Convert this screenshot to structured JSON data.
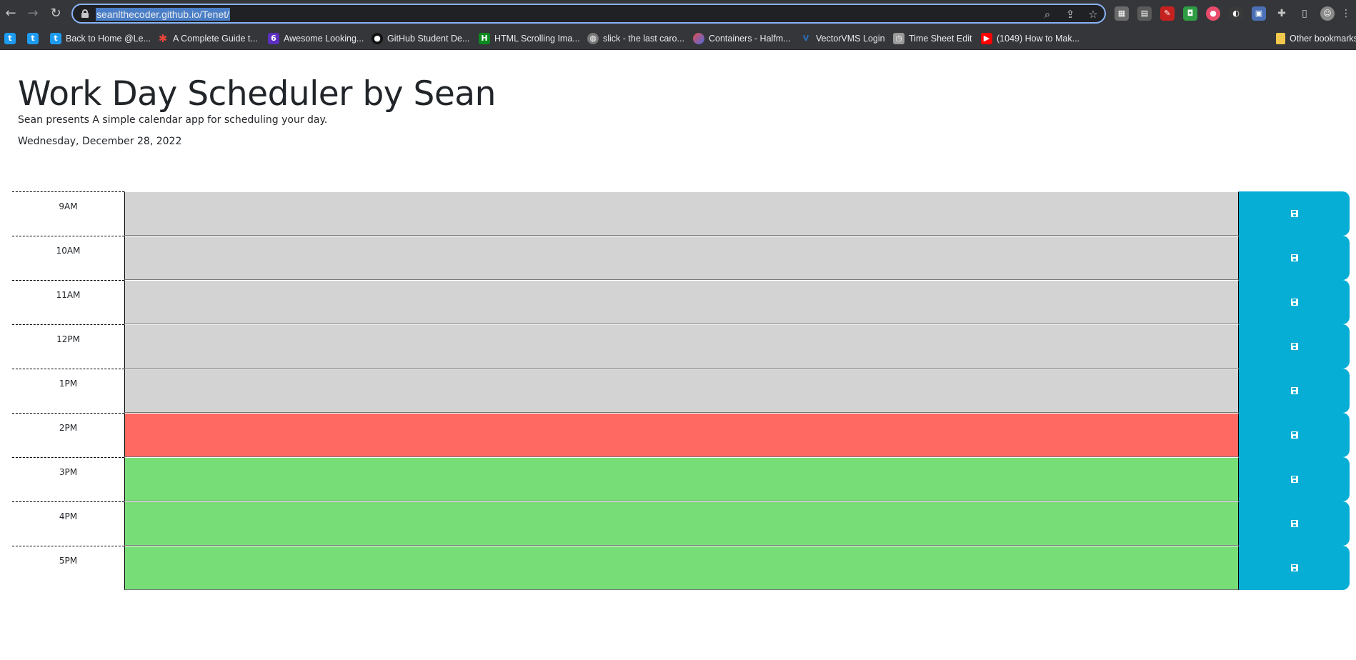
{
  "browser": {
    "url": "seanlthecoder.github.io/Tenet/",
    "bookmarks": [
      {
        "icon": "twitter-icon",
        "label": "",
        "color": "#1d9bf0"
      },
      {
        "icon": "twitter-icon",
        "label": "",
        "color": "#1d9bf0"
      },
      {
        "icon": "twitter-icon",
        "label": "Back to Home @Le...",
        "color": "#1d9bf0"
      },
      {
        "icon": "asterisk-icon",
        "label": "A Complete Guide t...",
        "color": "#e8453c"
      },
      {
        "icon": "six-icon",
        "label": "Awesome Looking...",
        "color": "#5b2fbf"
      },
      {
        "icon": "github-icon",
        "label": "GitHub Student De...",
        "color": "#111111"
      },
      {
        "icon": "h-icon",
        "label": "HTML Scrolling Ima...",
        "color": "#0c8a1f"
      },
      {
        "icon": "globe-icon",
        "label": "slick - the last caro...",
        "color": "#777777"
      },
      {
        "icon": "circle-logo-icon",
        "label": "Containers - Halfm...",
        "color": "#e24c4c"
      },
      {
        "icon": "v-icon",
        "label": "VectorVMS Login",
        "color": "#2a6ebb"
      },
      {
        "icon": "clock-icon",
        "label": "Time Sheet Edit",
        "color": "#9a9a9a"
      },
      {
        "icon": "youtube-icon",
        "label": "(1049) How to Mak...",
        "color": "#ff0000"
      }
    ],
    "other_bookmarks": "Other bookmarks"
  },
  "header": {
    "title": "Work Day Scheduler by Sean",
    "lead": "Sean presents A simple calendar app for scheduling your day.",
    "date": "Wednesday, December 28, 2022"
  },
  "colors": {
    "past": "#d3d3d3",
    "present": "#ff6961",
    "future": "#77dd77",
    "save": "#06aed5"
  },
  "rows": [
    {
      "hour": "9AM",
      "state": "past",
      "text": ""
    },
    {
      "hour": "10AM",
      "state": "past",
      "text": ""
    },
    {
      "hour": "11AM",
      "state": "past",
      "text": ""
    },
    {
      "hour": "12PM",
      "state": "past",
      "text": ""
    },
    {
      "hour": "1PM",
      "state": "past",
      "text": ""
    },
    {
      "hour": "2PM",
      "state": "present",
      "text": ""
    },
    {
      "hour": "3PM",
      "state": "future",
      "text": ""
    },
    {
      "hour": "4PM",
      "state": "future",
      "text": ""
    },
    {
      "hour": "5PM",
      "state": "future",
      "text": ""
    }
  ]
}
